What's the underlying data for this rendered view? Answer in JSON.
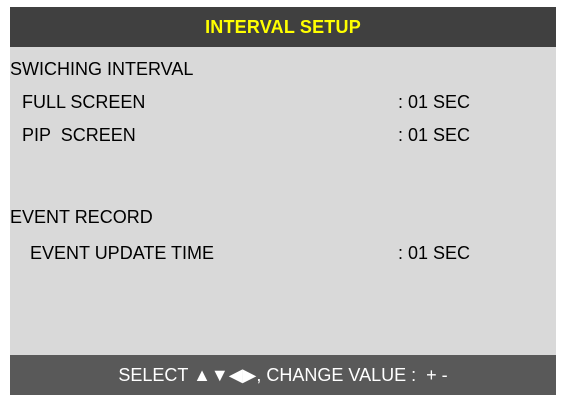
{
  "header": {
    "title": "INTERVAL SETUP"
  },
  "sections": {
    "switching": {
      "heading": "SWICHING INTERVAL",
      "full_screen_label": "FULL SCREEN",
      "full_screen_value": ": 01 SEC",
      "pip_screen_label": "PIP  SCREEN",
      "pip_screen_value": ": 01 SEC"
    },
    "event": {
      "heading": "EVENT RECORD",
      "update_time_label": "EVENT UPDATE TIME",
      "update_time_value": ": 01 SEC"
    }
  },
  "footer": {
    "hint": "SELECT ▲▼◀▶, CHANGE VALUE :  + -"
  },
  "colors": {
    "title_text": "#ffff00",
    "title_bar": "#404040",
    "panel_background": "#d9d9d9",
    "footer_bar": "#595959",
    "footer_text": "#ffffff"
  }
}
